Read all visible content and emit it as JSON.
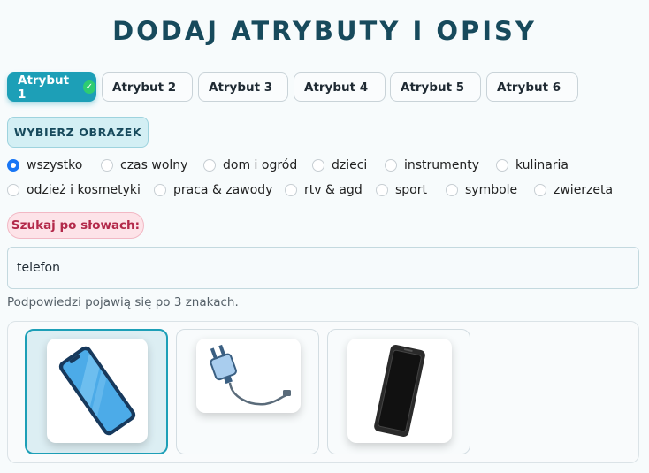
{
  "page": {
    "title": "DODAJ ATRYBUTY I OPISY"
  },
  "tabs": [
    {
      "label": "Atrybut 1",
      "active": true
    },
    {
      "label": "Atrybut 2",
      "active": false
    },
    {
      "label": "Atrybut 3",
      "active": false
    },
    {
      "label": "Atrybut 4",
      "active": false
    },
    {
      "label": "Atrybut 5",
      "active": false
    },
    {
      "label": "Atrybut 6",
      "active": false
    }
  ],
  "pick_image_button": "WYBIERZ OBRAZEK",
  "categories": {
    "selected": "wszystko",
    "row1": [
      "wszystko",
      "czas wolny",
      "dom i ogród",
      "dzieci",
      "instrumenty",
      "kulinaria"
    ],
    "row2": [
      "odzież i kosmetyki",
      "praca & zawody",
      "rtv & agd",
      "sport",
      "symbole",
      "zwierzeta"
    ]
  },
  "search": {
    "badge": "Szukaj po słowach:",
    "value": "telefon",
    "hint": "Podpowiedzi pojawią się po 3 znakach."
  },
  "results": [
    {
      "icon": "smartphone-blue-icon",
      "selected": true
    },
    {
      "icon": "phone-charger-icon",
      "selected": false
    },
    {
      "icon": "smartphone-black-icon",
      "selected": false
    }
  ],
  "colors": {
    "accent": "#1d9fb7",
    "title": "#174a5c",
    "badge": "#b3294a",
    "radio_selected": "#1976f5"
  }
}
